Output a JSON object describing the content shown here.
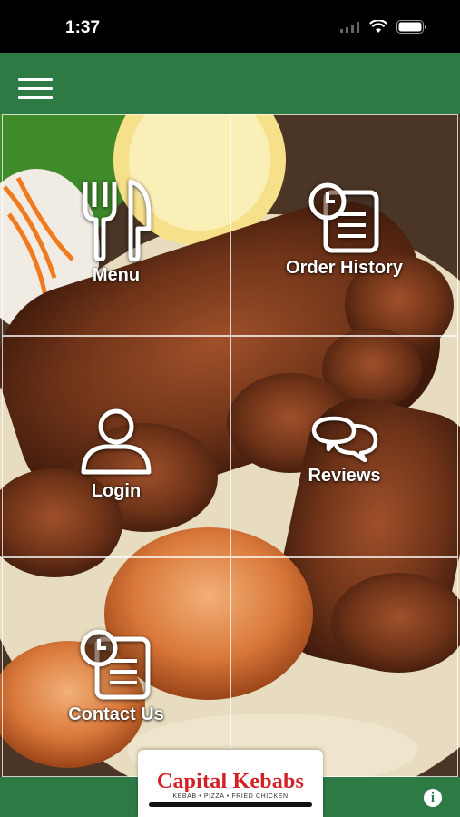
{
  "status_bar": {
    "time": "1:37"
  },
  "nav": {
    "menu_icon": "hamburger-icon"
  },
  "tiles": [
    {
      "label": "Menu",
      "icon": "fork-knife-icon"
    },
    {
      "label": "Order History",
      "icon": "order-history-icon"
    },
    {
      "label": "Login",
      "icon": "user-icon"
    },
    {
      "label": "Reviews",
      "icon": "chat-bubbles-icon"
    },
    {
      "label": "Contact Us",
      "icon": "contact-icon"
    }
  ],
  "branding": {
    "title": "Capital Kebabs",
    "subtitle": "KEBAB • PIZZA • FRIED CHICKEN"
  },
  "colors": {
    "brand_green": "#2e7a45",
    "logo_red": "#d32027"
  }
}
